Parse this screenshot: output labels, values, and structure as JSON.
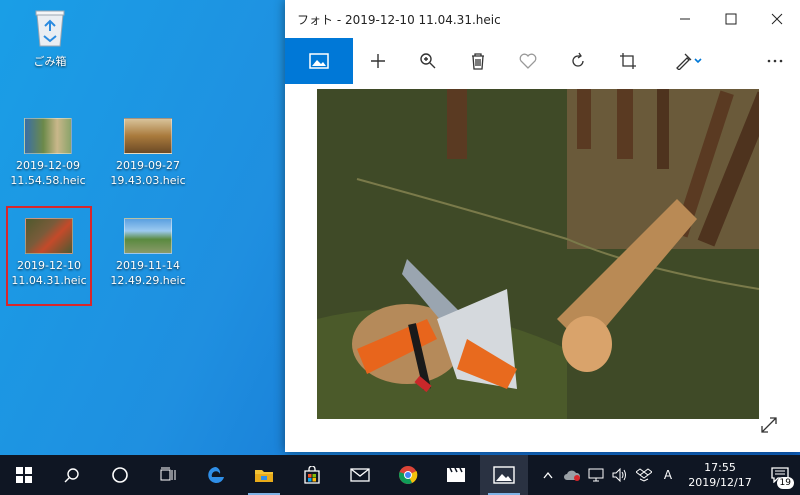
{
  "desktop": {
    "recycle_bin": {
      "label": "ごみ箱"
    },
    "icons": [
      {
        "label": "2019-12-09\n11.54.58.heic"
      },
      {
        "label": "2019-09-27\n19.43.03.heic"
      },
      {
        "label": "2019-12-10\n11.04.31.heic"
      },
      {
        "label": "2019-11-14\n12.49.29.heic"
      }
    ]
  },
  "photos_window": {
    "title": "フォト - 2019-12-10 11.04.31.heic",
    "toolbar": [
      "image-icon",
      "add-icon",
      "zoom-icon",
      "delete-icon",
      "heart-icon",
      "rotate-icon",
      "crop-icon",
      "edit-icon",
      "more-icon"
    ]
  },
  "taskbar": {
    "clock_time": "17:55",
    "clock_date": "2019/12/17",
    "ime": "A",
    "notification_count": "19"
  },
  "colors": {
    "accent": "#0078d7",
    "taskbar": "#0f1623",
    "selection": "#d8262b"
  }
}
